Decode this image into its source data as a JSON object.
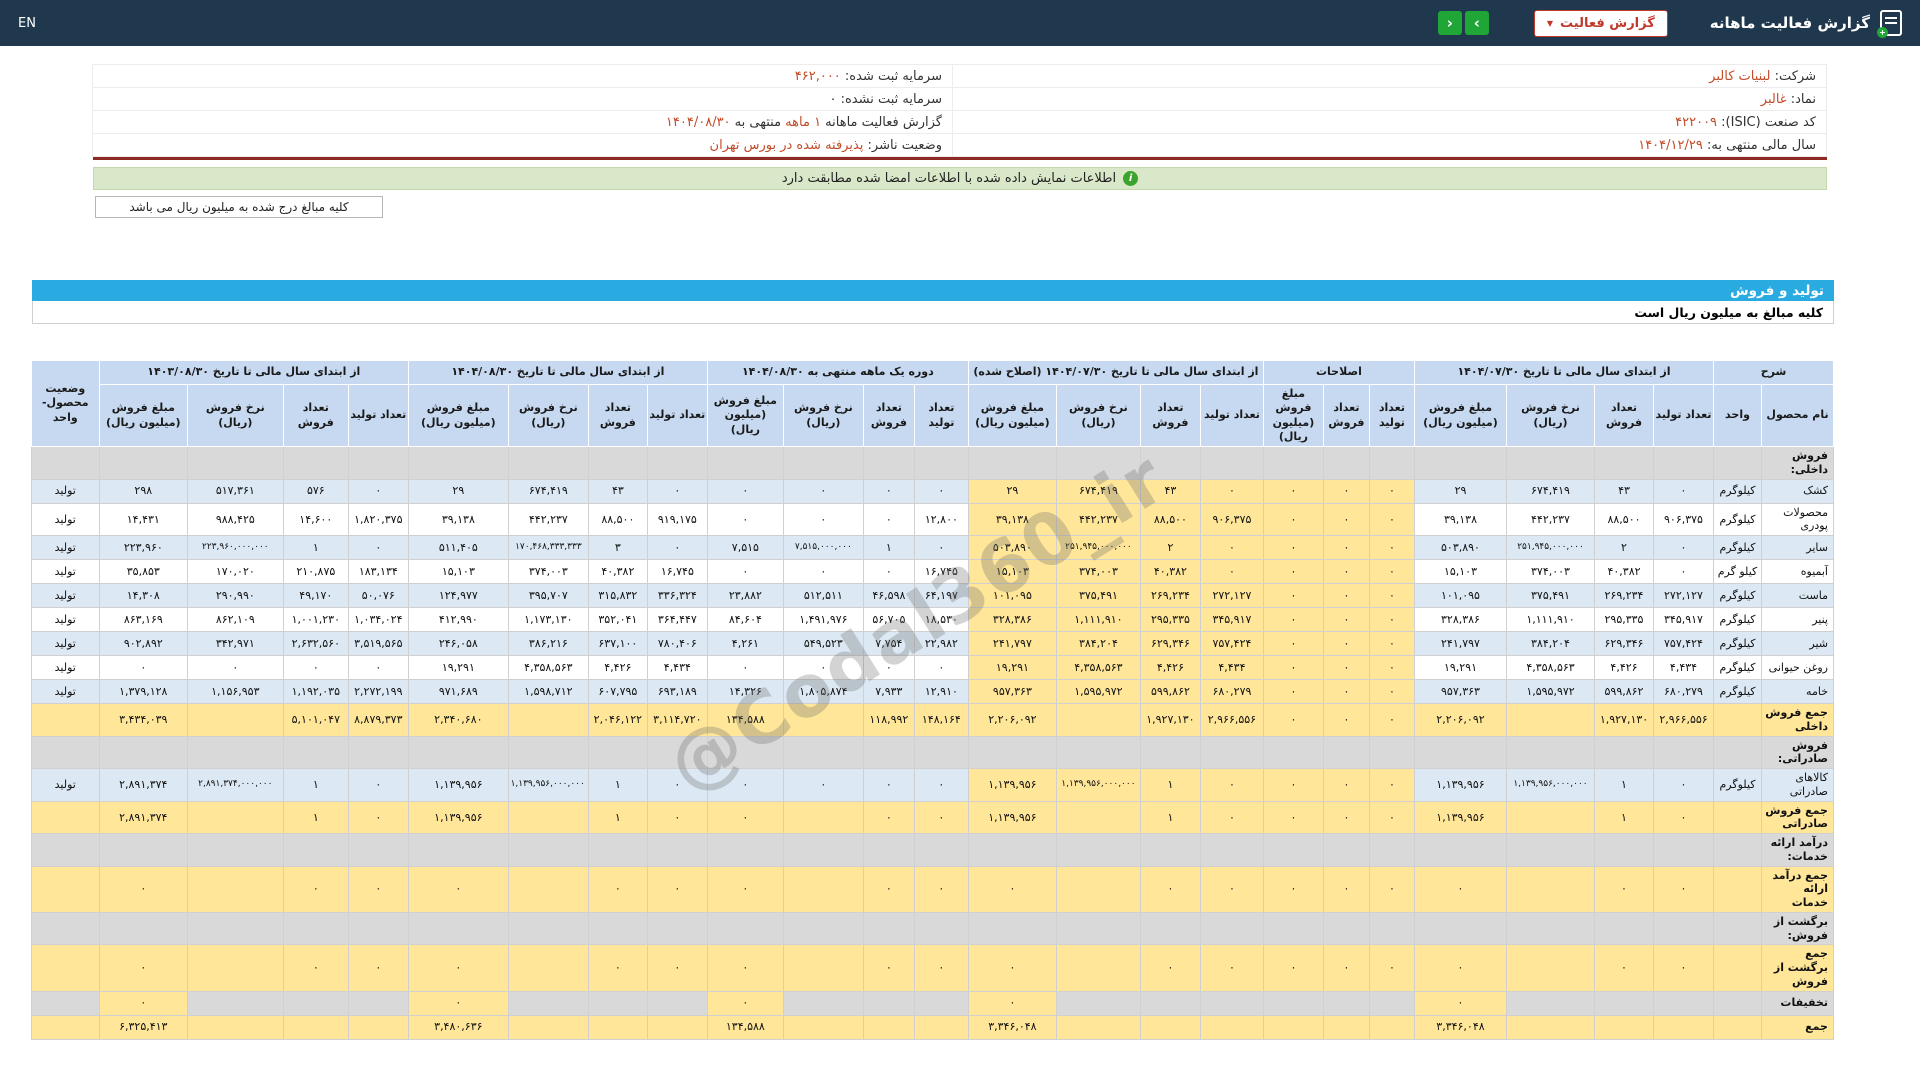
{
  "colors": {
    "topbar": "#20384d",
    "green": "#1fa637",
    "red": "#c0392b",
    "value_red": "#c24b28",
    "maroon": "#8e2a24",
    "notice_bg": "#d9e8c9",
    "notice_green": "#3da32f",
    "section_blue": "#29abe2",
    "header_blue": "#c6d9f0",
    "row_blue": "#dce8f3",
    "amber": "#ffe699",
    "gray_row": "#d9d9d9"
  },
  "topbar": {
    "title": "گزارش فعالیت ماهانه",
    "dropdown_label": "گزارش فعالیت",
    "nav_right": "›",
    "nav_left": "‹",
    "lang": "EN",
    "info_icon": "i",
    "caret": "▼"
  },
  "info": {
    "cells": [
      [
        {
          "t": "شرکت:  ",
          "r": false
        },
        {
          "t": "لبنیات کالبر",
          "r": true
        }
      ],
      [
        {
          "t": "سرمایه ثبت شده:  ",
          "r": false
        },
        {
          "t": "۴۶۲,۰۰۰",
          "r": true
        }
      ],
      [
        {
          "t": "نماد:  ",
          "r": false
        },
        {
          "t": "غالبر",
          "r": true
        }
      ],
      [
        {
          "t": "سرمایه ثبت نشده:  ",
          "r": false
        },
        {
          "t": "۰",
          "r": false
        }
      ],
      [
        {
          "t": "کد صنعت (ISIC):  ",
          "r": false
        },
        {
          "t": "۴۲۲۰۰۹",
          "r": true
        }
      ],
      [
        {
          "t": "گزارش فعالیت ماهانه ",
          "r": false
        },
        {
          "t": "۱ ماهه",
          "r": true
        },
        {
          "t": " منتهی به ",
          "r": false
        },
        {
          "t": "۱۴۰۴/۰۸/۳۰",
          "r": true
        }
      ],
      [
        {
          "t": "سال مالی منتهی به:  ",
          "r": false
        },
        {
          "t": "۱۴۰۴/۱۲/۲۹",
          "r": true
        }
      ],
      [
        {
          "t": "وضعیت ناشر:  ",
          "r": false
        },
        {
          "t": "پذیرفته شده در بورس تهران",
          "r": true
        }
      ]
    ]
  },
  "notice": "اطلاعات نمایش داده شده با اطلاعات امضا شده مطابقت دارد",
  "unit_note": "کلیه مبالغ درج شده به میلیون ریال می باشد",
  "section": {
    "title": "تولید و فروش",
    "subtitle": "کلیه مبالغ به میلیون ریال است"
  },
  "watermark": "@Codal360_ir",
  "table": {
    "desc_header": "شرح",
    "status_header": "وضعیت محصول- واحد",
    "groups": [
      {
        "label": "از ابتدای سال مالی تا تاریخ ۱۴۰۴/۰۷/۳۰",
        "cols": 4
      },
      {
        "label": "اصلاحات",
        "cols": 3
      },
      {
        "label": "از ابتدای سال مالی تا تاریخ ۱۴۰۴/۰۷/۳۰ (اصلاح شده)",
        "cols": 4
      },
      {
        "label": "دوره یک ماهه منتهی به ۱۴۰۴/۰۸/۳۰",
        "cols": 4
      },
      {
        "label": "از ابتدای سال مالی تا تاریخ ۱۴۰۴/۰۸/۳۰",
        "cols": 4
      },
      {
        "label": "از ابتدای سال مالی تا تاریخ ۱۴۰۳/۰۸/۳۰",
        "cols": 4
      }
    ],
    "sub_headers": {
      "name": "نام محصول",
      "unit": "واحد",
      "qty_prod": "تعداد تولید",
      "qty_sold": "تعداد فروش",
      "rate": "نرخ فروش (ریال)",
      "amount": "مبلغ فروش (میلیون ریال)"
    },
    "rows": [
      {
        "type": "section",
        "name": "فروش داخلی:"
      },
      {
        "type": "product",
        "alt": true,
        "name": "کشک",
        "unit": "کیلوگرم",
        "status": "تولید",
        "cells": [
          "۰",
          "۴۳",
          "۶۷۴,۴۱۹",
          "۲۹",
          "۰",
          "۰",
          "۰",
          "۰",
          "۴۳",
          "۶۷۴,۴۱۹",
          "۲۹",
          "۰",
          "۰",
          "۰",
          "۰",
          "۰",
          "۴۳",
          "۶۷۴,۴۱۹",
          "۲۹",
          "۰",
          "۵۷۶",
          "۵۱۷,۳۶۱",
          "۲۹۸"
        ]
      },
      {
        "type": "product",
        "alt": false,
        "name": "محصولات پودری",
        "unit": "کیلوگرم",
        "status": "تولید",
        "cells": [
          "۹۰۶,۳۷۵",
          "۸۸,۵۰۰",
          "۴۴۲,۲۳۷",
          "۳۹,۱۳۸",
          "۰",
          "۰",
          "۰",
          "۹۰۶,۳۷۵",
          "۸۸,۵۰۰",
          "۴۴۲,۲۳۷",
          "۳۹,۱۳۸",
          "۱۲,۸۰۰",
          "۰",
          "۰",
          "۰",
          "۹۱۹,۱۷۵",
          "۸۸,۵۰۰",
          "۴۴۲,۲۳۷",
          "۳۹,۱۳۸",
          "۱,۸۲۰,۳۷۵",
          "۱۴,۶۰۰",
          "۹۸۸,۴۲۵",
          "۱۴,۴۳۱"
        ]
      },
      {
        "type": "product",
        "alt": true,
        "name": "سایر",
        "unit": "کیلوگرم",
        "status": "تولید",
        "cells": [
          "۰",
          "۲",
          "۲۵۱,۹۴۵,۰۰۰,۰۰۰",
          "۵۰۳,۸۹۰",
          "۰",
          "۰",
          "۰",
          "۰",
          "۲",
          "۲۵۱,۹۴۵,۰۰۰,۰۰۰",
          "۵۰۳,۸۹۰",
          "۰",
          "۱",
          "۷,۵۱۵,۰۰۰,۰۰۰",
          "۷,۵۱۵",
          "۰",
          "۳",
          "۱۷۰,۴۶۸,۳۳۳,۳۳۳",
          "۵۱۱,۴۰۵",
          "۰",
          "۱",
          "۲۲۳,۹۶۰,۰۰۰,۰۰۰",
          "۲۲۳,۹۶۰"
        ]
      },
      {
        "type": "product",
        "alt": false,
        "name": "آبمیوه",
        "unit": "کیلو گرم",
        "status": "تولید",
        "cells": [
          "۰",
          "۴۰,۳۸۲",
          "۳۷۴,۰۰۳",
          "۱۵,۱۰۳",
          "۰",
          "۰",
          "۰",
          "۰",
          "۴۰,۳۸۲",
          "۳۷۴,۰۰۳",
          "۱۵,۱۰۳",
          "۱۶,۷۴۵",
          "۰",
          "۰",
          "۰",
          "۱۶,۷۴۵",
          "۴۰,۳۸۲",
          "۳۷۴,۰۰۳",
          "۱۵,۱۰۳",
          "۱۸۳,۱۳۴",
          "۲۱۰,۸۷۵",
          "۱۷۰,۰۲۰",
          "۳۵,۸۵۳"
        ]
      },
      {
        "type": "product",
        "alt": true,
        "name": "ماست",
        "unit": "کیلوگرم",
        "status": "تولید",
        "cells": [
          "۲۷۲,۱۲۷",
          "۲۶۹,۲۳۴",
          "۳۷۵,۴۹۱",
          "۱۰۱,۰۹۵",
          "۰",
          "۰",
          "۰",
          "۲۷۲,۱۲۷",
          "۲۶۹,۲۳۴",
          "۳۷۵,۴۹۱",
          "۱۰۱,۰۹۵",
          "۶۴,۱۹۷",
          "۴۶,۵۹۸",
          "۵۱۲,۵۱۱",
          "۲۳,۸۸۲",
          "۳۳۶,۳۲۴",
          "۳۱۵,۸۳۲",
          "۳۹۵,۷۰۷",
          "۱۲۴,۹۷۷",
          "۵۰,۰۷۶",
          "۴۹,۱۷۰",
          "۲۹۰,۹۹۰",
          "۱۴,۳۰۸"
        ]
      },
      {
        "type": "product",
        "alt": false,
        "name": "پنیر",
        "unit": "کیلوگرم",
        "status": "تولید",
        "cells": [
          "۳۴۵,۹۱۷",
          "۲۹۵,۳۳۵",
          "۱,۱۱۱,۹۱۰",
          "۳۲۸,۳۸۶",
          "۰",
          "۰",
          "۰",
          "۳۴۵,۹۱۷",
          "۲۹۵,۳۳۵",
          "۱,۱۱۱,۹۱۰",
          "۳۲۸,۳۸۶",
          "۱۸,۵۳۰",
          "۵۶,۷۰۵",
          "۱,۴۹۱,۹۷۶",
          "۸۴,۶۰۴",
          "۳۶۴,۴۴۷",
          "۳۵۲,۰۴۱",
          "۱,۱۷۳,۱۳۰",
          "۴۱۲,۹۹۰",
          "۱,۰۳۴,۰۲۴",
          "۱,۰۰۱,۲۳۰",
          "۸۶۲,۱۰۹",
          "۸۶۳,۱۶۹"
        ]
      },
      {
        "type": "product",
        "alt": true,
        "name": "شیر",
        "unit": "کیلوگرم",
        "status": "تولید",
        "cells": [
          "۷۵۷,۴۲۴",
          "۶۲۹,۳۴۶",
          "۳۸۴,۲۰۴",
          "۲۴۱,۷۹۷",
          "۰",
          "۰",
          "۰",
          "۷۵۷,۴۲۴",
          "۶۲۹,۳۴۶",
          "۳۸۴,۲۰۴",
          "۲۴۱,۷۹۷",
          "۲۲,۹۸۲",
          "۷,۷۵۴",
          "۵۴۹,۵۲۳",
          "۴,۲۶۱",
          "۷۸۰,۴۰۶",
          "۶۳۷,۱۰۰",
          "۳۸۶,۲۱۶",
          "۲۴۶,۰۵۸",
          "۳,۵۱۹,۵۶۵",
          "۲,۶۳۲,۵۶۰",
          "۳۴۲,۹۷۱",
          "۹۰۲,۸۹۲"
        ]
      },
      {
        "type": "product",
        "alt": false,
        "name": "روغن حیوانی",
        "unit": "کیلوگرم",
        "status": "تولید",
        "cells": [
          "۴,۴۳۴",
          "۴,۴۲۶",
          "۴,۳۵۸,۵۶۳",
          "۱۹,۲۹۱",
          "۰",
          "۰",
          "۰",
          "۴,۴۳۴",
          "۴,۴۲۶",
          "۴,۳۵۸,۵۶۳",
          "۱۹,۲۹۱",
          "۰",
          "۰",
          "۰",
          "۰",
          "۴,۴۳۴",
          "۴,۴۲۶",
          "۴,۳۵۸,۵۶۳",
          "۱۹,۲۹۱",
          "۰",
          "۰",
          "۰",
          "۰"
        ]
      },
      {
        "type": "product",
        "alt": true,
        "name": "خامه",
        "unit": "کیلوگرم",
        "status": "تولید",
        "cells": [
          "۶۸۰,۲۷۹",
          "۵۹۹,۸۶۲",
          "۱,۵۹۵,۹۷۲",
          "۹۵۷,۳۶۳",
          "۰",
          "۰",
          "۰",
          "۶۸۰,۲۷۹",
          "۵۹۹,۸۶۲",
          "۱,۵۹۵,۹۷۲",
          "۹۵۷,۳۶۳",
          "۱۲,۹۱۰",
          "۷,۹۳۳",
          "۱,۸۰۵,۸۷۴",
          "۱۴,۳۲۶",
          "۶۹۳,۱۸۹",
          "۶۰۷,۷۹۵",
          "۱,۵۹۸,۷۱۲",
          "۹۷۱,۶۸۹",
          "۲,۲۷۲,۱۹۹",
          "۱,۱۹۲,۰۳۵",
          "۱,۱۵۶,۹۵۳",
          "۱,۳۷۹,۱۲۸"
        ]
      },
      {
        "type": "sum",
        "name": "جمع فروش داخلی",
        "cells": [
          "۲,۹۶۶,۵۵۶",
          "۱,۹۲۷,۱۳۰",
          "",
          "۲,۲۰۶,۰۹۲",
          "۰",
          "۰",
          "۰",
          "۲,۹۶۶,۵۵۶",
          "۱,۹۲۷,۱۳۰",
          "",
          "۲,۲۰۶,۰۹۲",
          "۱۴۸,۱۶۴",
          "۱۱۸,۹۹۲",
          "",
          "۱۳۴,۵۸۸",
          "۳,۱۱۴,۷۲۰",
          "۲,۰۴۶,۱۲۲",
          "",
          "۲,۳۴۰,۶۸۰",
          "۸,۸۷۹,۳۷۳",
          "۵,۱۰۱,۰۴۷",
          "",
          "۳,۴۳۴,۰۳۹"
        ]
      },
      {
        "type": "section",
        "name": "فروش صادراتی:"
      },
      {
        "type": "product",
        "alt": true,
        "name": "کالاهای صادراتی",
        "unit": "کیلوگرم",
        "status": "تولید",
        "cells": [
          "۰",
          "۱",
          "۱,۱۳۹,۹۵۶,۰۰۰,۰۰۰",
          "۱,۱۳۹,۹۵۶",
          "۰",
          "۰",
          "۰",
          "۰",
          "۱",
          "۱,۱۳۹,۹۵۶,۰۰۰,۰۰۰",
          "۱,۱۳۹,۹۵۶",
          "۰",
          "۰",
          "۰",
          "۰",
          "۰",
          "۱",
          "۱,۱۳۹,۹۵۶,۰۰۰,۰۰۰",
          "۱,۱۳۹,۹۵۶",
          "۰",
          "۱",
          "۲,۸۹۱,۳۷۴,۰۰۰,۰۰۰",
          "۲,۸۹۱,۳۷۴"
        ]
      },
      {
        "type": "sum",
        "name": "جمع فروش صادراتی",
        "cells": [
          "۰",
          "۱",
          "",
          "۱,۱۳۹,۹۵۶",
          "۰",
          "۰",
          "۰",
          "۰",
          "۱",
          "",
          "۱,۱۳۹,۹۵۶",
          "۰",
          "۰",
          "",
          "۰",
          "۰",
          "۱",
          "",
          "۱,۱۳۹,۹۵۶",
          "۰",
          "۱",
          "",
          "۲,۸۹۱,۳۷۴"
        ]
      },
      {
        "type": "section",
        "name": "درآمد ارائه خدمات:"
      },
      {
        "type": "sum",
        "name": "جمع درآمد ارائه خدمات",
        "cells": [
          "۰",
          "۰",
          "",
          "۰",
          "۰",
          "۰",
          "۰",
          "۰",
          "۰",
          "",
          "۰",
          "۰",
          "۰",
          "",
          "۰",
          "۰",
          "۰",
          "",
          "۰",
          "۰",
          "۰",
          "",
          "۰"
        ]
      },
      {
        "type": "section",
        "name": "برگشت از فروش:"
      },
      {
        "type": "sum",
        "name": "جمع برگشت از فروش",
        "cells": [
          "۰",
          "۰",
          "",
          "۰",
          "۰",
          "۰",
          "۰",
          "۰",
          "۰",
          "",
          "۰",
          "۰",
          "۰",
          "",
          "۰",
          "۰",
          "۰",
          "",
          "۰",
          "۰",
          "۰",
          "",
          "۰"
        ]
      },
      {
        "type": "discount",
        "name": "تخفیفات",
        "cells": [
          "",
          "",
          "",
          "۰",
          "",
          "",
          "",
          "",
          "",
          "",
          "۰",
          "",
          "",
          "",
          "۰",
          "",
          "",
          "",
          "۰",
          "",
          "",
          "",
          "۰"
        ]
      },
      {
        "type": "total",
        "name": "جمع",
        "cells": [
          "",
          "",
          "",
          "۳,۳۴۶,۰۴۸",
          "",
          "",
          "",
          "",
          "",
          "",
          "۳,۳۴۶,۰۴۸",
          "",
          "",
          "",
          "۱۳۴,۵۸۸",
          "",
          "",
          "",
          "۳,۴۸۰,۶۳۶",
          "",
          "",
          "",
          "۶,۳۲۵,۴۱۳"
        ]
      }
    ]
  }
}
